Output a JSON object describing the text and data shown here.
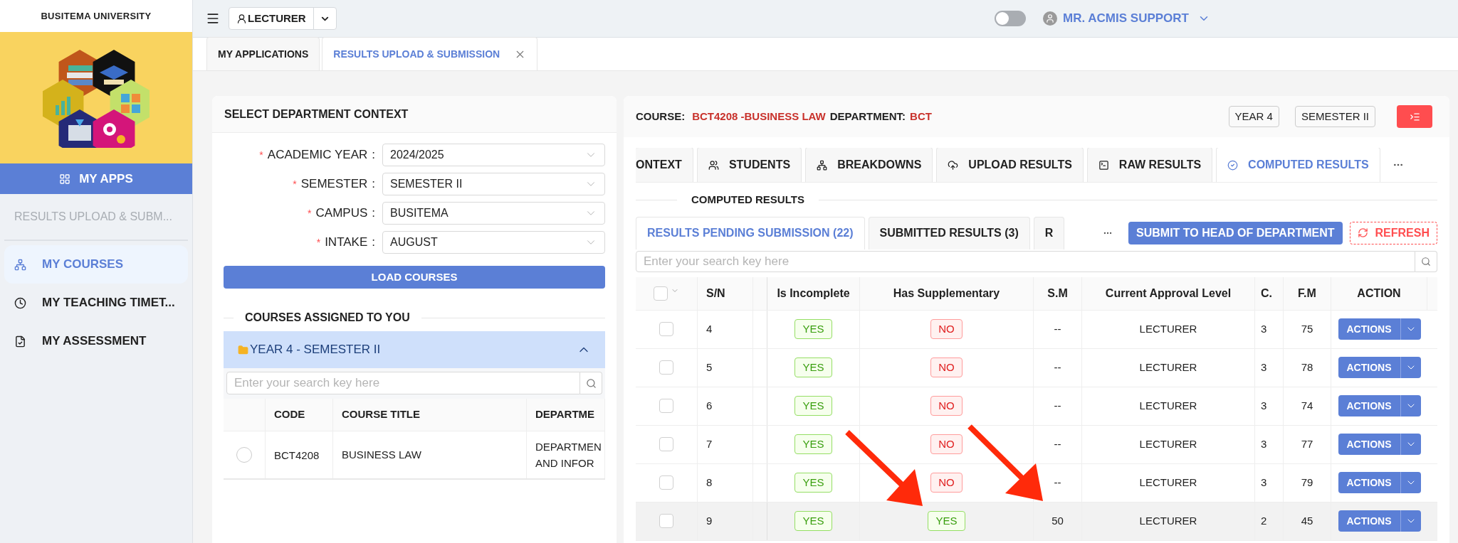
{
  "sidebar": {
    "title": "BUSITEMA UNIVERSITY",
    "apps_button": "MY APPS",
    "section_label": "RESULTS UPLOAD & SUBM...",
    "items": [
      {
        "label": "MY COURSES",
        "selected": true
      },
      {
        "label": "MY TEACHING TIMET...",
        "selected": false
      },
      {
        "label": "MY ASSESSMENT",
        "selected": false
      }
    ]
  },
  "topbar": {
    "role": "LECTURER",
    "theme_toggle": {
      "on": false
    },
    "user": "MR. ACMIS SUPPORT"
  },
  "page_tabs": [
    {
      "label": "MY APPLICATIONS",
      "selected": false,
      "closable": false
    },
    {
      "label": "RESULTS UPLOAD & SUBMISSION",
      "selected": true,
      "closable": true
    }
  ],
  "context_panel": {
    "title": "SELECT DEPARTMENT CONTEXT",
    "fields": [
      {
        "marker": "*",
        "label": "ACADEMIC YEAR",
        "colon": ":",
        "value": "2024/2025"
      },
      {
        "marker": "*",
        "label": "SEMESTER",
        "colon": ":",
        "value": "SEMESTER II"
      },
      {
        "marker": "*",
        "label": "CAMPUS",
        "colon": ":",
        "value": "BUSITEMA"
      },
      {
        "marker": "*",
        "label": "INTAKE",
        "colon": ":",
        "value": "AUGUST"
      }
    ],
    "load_button": "LOAD COURSES",
    "courses_heading": "COURSES ASSIGNED TO YOU",
    "group": {
      "label": "YEAR 4 - SEMESTER II",
      "expanded": true
    },
    "search": {
      "placeholder": "Enter your search key here"
    },
    "table": {
      "columns": [
        "CODE",
        "COURSE TITLE",
        "DEPARTME"
      ],
      "rows": [
        {
          "selected": false,
          "cells": [
            "BCT4208",
            "BUSINESS LAW",
            "DEPARTMEN AND INFOR"
          ]
        }
      ]
    }
  },
  "results_panel": {
    "course_label": "COURSE:",
    "course_value": "BCT4208 -BUSINESS LAW",
    "department_label": "DEPARTMENT:",
    "department_value": "BCT",
    "badges": [
      "YEAR 4",
      "SEMESTER II"
    ],
    "tabs": [
      {
        "label": "ONTEXT",
        "selected": false
      },
      {
        "label": "STUDENTS",
        "selected": false
      },
      {
        "label": "BREAKDOWNS",
        "selected": false
      },
      {
        "label": "UPLOAD RESULTS",
        "selected": false
      },
      {
        "label": "RAW RESULTS",
        "selected": false
      },
      {
        "label": "COMPUTED RESULTS",
        "selected": true
      }
    ],
    "section_title": "COMPUTED RESULTS",
    "sub_tabs": [
      {
        "label": "RESULTS PENDING SUBMISSION (22)",
        "selected": true
      },
      {
        "label": "SUBMITTED RESULTS (3)",
        "selected": false
      },
      {
        "label": "R",
        "selected": false
      }
    ],
    "submit_button": "SUBMIT TO HEAD OF DEPARTMENT",
    "refresh_button": "REFRESH",
    "search": {
      "placeholder": "Enter your search key here"
    },
    "table": {
      "all_checked": false,
      "columns": [
        "S/N",
        "Is Incomplete",
        "Has Supplementary",
        "S.M",
        "Current Approval Level",
        "C.",
        "F.M",
        "ACTION"
      ],
      "rows": [
        {
          "checked": false,
          "hovered": false,
          "sn": "4",
          "incomplete": {
            "label": "YES",
            "positive": true
          },
          "supplementary": {
            "label": "NO",
            "positive": false
          },
          "sm": "--",
          "level": "LECTURER",
          "cw": "3",
          "fm": "75",
          "action": "ACTIONS"
        },
        {
          "checked": false,
          "hovered": false,
          "sn": "5",
          "incomplete": {
            "label": "YES",
            "positive": true
          },
          "supplementary": {
            "label": "NO",
            "positive": false
          },
          "sm": "--",
          "level": "LECTURER",
          "cw": "3",
          "fm": "78",
          "action": "ACTIONS"
        },
        {
          "checked": false,
          "hovered": false,
          "sn": "6",
          "incomplete": {
            "label": "YES",
            "positive": true
          },
          "supplementary": {
            "label": "NO",
            "positive": false
          },
          "sm": "--",
          "level": "LECTURER",
          "cw": "3",
          "fm": "74",
          "action": "ACTIONS"
        },
        {
          "checked": false,
          "hovered": false,
          "sn": "7",
          "incomplete": {
            "label": "YES",
            "positive": true
          },
          "supplementary": {
            "label": "NO",
            "positive": false
          },
          "sm": "--",
          "level": "LECTURER",
          "cw": "3",
          "fm": "77",
          "action": "ACTIONS"
        },
        {
          "checked": false,
          "hovered": false,
          "sn": "8",
          "incomplete": {
            "label": "YES",
            "positive": true
          },
          "supplementary": {
            "label": "NO",
            "positive": false
          },
          "sm": "--",
          "level": "LECTURER",
          "cw": "3",
          "fm": "79",
          "action": "ACTIONS"
        },
        {
          "checked": false,
          "hovered": true,
          "sn": "9",
          "incomplete": {
            "label": "YES",
            "positive": true
          },
          "supplementary": {
            "label": "YES",
            "positive": true
          },
          "sm": "50",
          "level": "LECTURER",
          "cw": "2",
          "fm": "45",
          "action": "ACTIONS"
        }
      ]
    }
  }
}
